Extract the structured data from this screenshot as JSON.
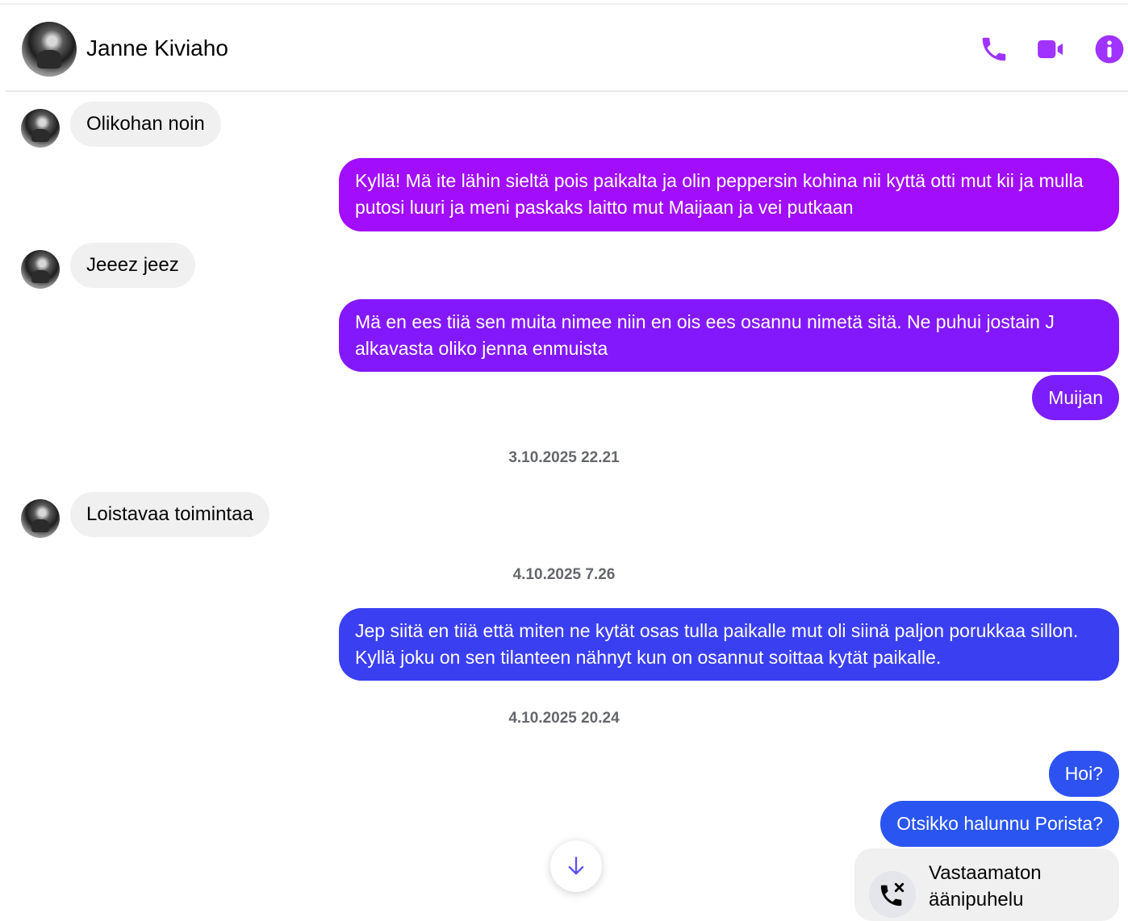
{
  "colors": {
    "accent": "#a033ff",
    "bubble_incoming": "#f0f0f0",
    "gradient_top": "#a100fc",
    "gradient_mid": "#7b1bff",
    "gradient_bottom": "#2e4ef0"
  },
  "header": {
    "contact_name": "Janne Kiviaho",
    "icons": [
      "phone-icon",
      "video-camera-icon",
      "info-icon"
    ]
  },
  "messages": [
    {
      "direction": "in",
      "text": "Olikohan noin"
    },
    {
      "direction": "out",
      "text": "Kyllä! Mä ite lähin sieltä pois paikalta ja olin peppersin kohina nii kyttä otti mut kii ja mulla putosi luuri ja meni paskaks laitto mut Maijaan ja vei putkaan"
    },
    {
      "direction": "in",
      "text": "Jeeez jeez"
    },
    {
      "direction": "out",
      "text": "Mä en ees tiiä sen muita nimee niin en ois ees osannu nimetä sitä. Ne puhui jostain J alkavasta oliko jenna enmuista"
    },
    {
      "direction": "out",
      "text": "Muijan"
    },
    {
      "direction": "in",
      "text": "Loistavaa toimintaa"
    },
    {
      "direction": "out",
      "text": "Jep siitä en tiiä että miten ne kytät osas tulla paikalle mut oli siinä paljon porukkaa sillon. Kyllä joku on sen tilanteen nähnyt kun on osannut soittaa kytät paikalle."
    },
    {
      "direction": "out",
      "text": "Hoi?"
    },
    {
      "direction": "out",
      "text": "Otsikko halunnu Porista?"
    }
  ],
  "timestamps": [
    "3.10.2025 22.21",
    "4.10.2025 7.26",
    "4.10.2025 20.24"
  ],
  "missed_call": {
    "line1": "Vastaamaton",
    "line2": "äänipuhelu",
    "icon": "missed-call-icon"
  },
  "scroll_button": {
    "icon": "arrow-down-icon"
  }
}
